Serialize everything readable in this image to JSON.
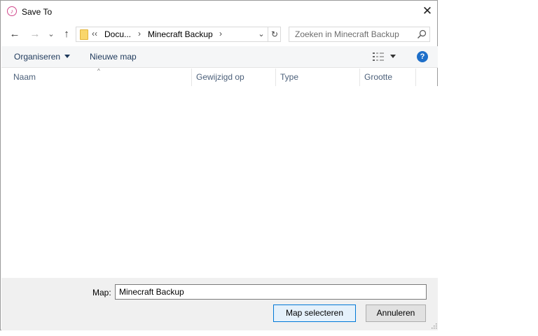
{
  "window": {
    "title": "Save To",
    "close_glyph": "✕"
  },
  "nav": {
    "back_glyph": "←",
    "forward_glyph": "→",
    "recent_glyph": "⌄",
    "up_glyph": "↑"
  },
  "address": {
    "overflow": "‹‹",
    "crumbs": [
      "Docu...",
      "Minecraft Backup"
    ],
    "separator": "›",
    "dropdown_glyph": "⌄",
    "refresh_glyph": "↻"
  },
  "search": {
    "placeholder": "Zoeken in Minecraft Backup"
  },
  "toolbar": {
    "organize_label": "Organiseren",
    "new_folder_label": "Nieuwe map",
    "help_label": "?"
  },
  "columns": [
    {
      "label": "Naam"
    },
    {
      "label": "Gewijzigd op"
    },
    {
      "label": "Type"
    },
    {
      "label": "Grootte"
    }
  ],
  "sort_glyph": "^",
  "bottom": {
    "folder_label": "Map:",
    "folder_value": "Minecraft Backup",
    "select_button": "Map selecteren",
    "cancel_button": "Annuleren"
  },
  "colors": {
    "accent": "#0078d7",
    "toolbar_text": "#1e395b",
    "help": "#1e6fc9"
  }
}
